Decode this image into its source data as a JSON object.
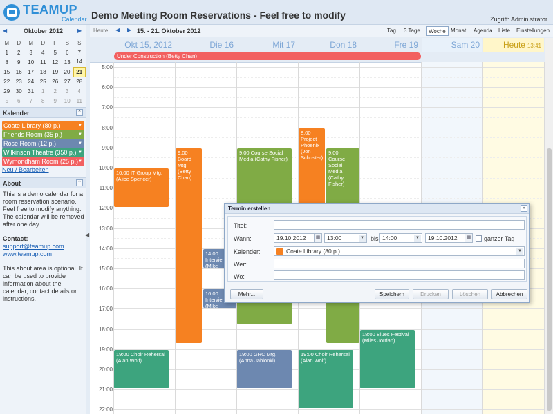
{
  "header": {
    "logo_text": "TEAMUP",
    "logo_sub": "Calendar",
    "title": "Demo Meeting Room Reservations - Feel free to modify",
    "access": "Zugriff: Administrator"
  },
  "mini_calendar": {
    "month": "Oktober 2012",
    "weekdays": [
      "M",
      "D",
      "M",
      "D",
      "F",
      "S",
      "S"
    ],
    "weeks": [
      [
        "1",
        "2",
        "3",
        "4",
        "5",
        "6",
        "7"
      ],
      [
        "8",
        "9",
        "10",
        "11",
        "12",
        "13",
        "14"
      ],
      [
        "15",
        "16",
        "17",
        "18",
        "19",
        "20",
        "21"
      ],
      [
        "22",
        "23",
        "24",
        "25",
        "26",
        "27",
        "28"
      ],
      [
        "29",
        "30",
        "31",
        "1",
        "2",
        "3",
        "4"
      ],
      [
        "5",
        "6",
        "7",
        "8",
        "9",
        "10",
        "11"
      ]
    ]
  },
  "calendars_panel": {
    "title": "Kalender",
    "items": [
      {
        "label": "Coate Library (80 p.)",
        "color": "#f68121"
      },
      {
        "label": "Friends Room (35 p.)",
        "color": "#80ab45"
      },
      {
        "label": "Rose Room (12 p.)",
        "color": "#6d88b0"
      },
      {
        "label": "Wilkinson Theatre (350 p.)",
        "color": "#3da47e"
      },
      {
        "label": "Wymondham Room (25 p.)",
        "color": "#f26060"
      }
    ],
    "edit_link": "Neu / Bearbeiten"
  },
  "about_panel": {
    "title": "About",
    "text1": "This is a demo calendar for a room reservation scenario. Feel free to modify anything. The calendar will be removed after one day.",
    "contact_label": "Contact",
    "email": "support@teamup.com",
    "website": "www.teamup.com",
    "text2": "This about area is optional. It can be used to provide information about the calendar, contact details or instructions."
  },
  "toolbar": {
    "today": "Heute",
    "range": "15. - 21. Oktober 2012",
    "views": [
      "Tag",
      "3 Tage",
      "Woche",
      "Monat",
      "Agenda",
      "Liste",
      "Einstellungen"
    ],
    "active_view": "Woche"
  },
  "days": [
    {
      "label": "Okt 15, 2012"
    },
    {
      "label": "Die 16"
    },
    {
      "label": "Mit 17"
    },
    {
      "label": "Don 18"
    },
    {
      "label": "Fre 19"
    },
    {
      "label": "Sam 20"
    },
    {
      "label": "Heute",
      "extra": "13:41"
    }
  ],
  "hours": [
    "5:00",
    "6:00",
    "7:00",
    "8:00",
    "9:00",
    "10:00",
    "11:00",
    "12:00",
    "13:00",
    "14:00",
    "15:00",
    "16:00",
    "17:00",
    "18:00",
    "19:00",
    "20:00",
    "21:00",
    "22:00"
  ],
  "allday_event": {
    "title": "Under Construction (Betty Chan)"
  },
  "events": [
    {
      "day": 0,
      "start": 10,
      "end": 12,
      "cal": "orange",
      "lines": [
        "10:00 IT Group Mtg.",
        "(Alice Spencer)"
      ]
    },
    {
      "day": 1,
      "start": 9,
      "end": 18.75,
      "cal": "orange",
      "lines": [
        "9:00",
        "Board",
        "Mtg.",
        "(Betty",
        "Chan)"
      ]
    },
    {
      "day": 1.45,
      "start": 14,
      "end": 15,
      "cal": "blue",
      "lines": [
        "14:00",
        "Intervie",
        "(Mike"
      ]
    },
    {
      "day": 1.45,
      "start": 16,
      "end": 17,
      "cal": "blue",
      "lines": [
        "16:00",
        "Intervie",
        "(Mike"
      ]
    },
    {
      "day": 2,
      "start": 9,
      "end": 17.8,
      "cal": "green",
      "lines": [
        "9:00 Course Social",
        "Media (Cathy Fisher)"
      ]
    },
    {
      "day": 3,
      "start": 8,
      "end": 12.5,
      "cal": "orange",
      "lines": [
        "8:00",
        "Project",
        "Phoenix",
        "(Jon",
        "Schuster)"
      ]
    },
    {
      "day": 3.45,
      "start": 9,
      "end": 18.75,
      "cal": "green",
      "lines": [
        "9:00",
        "Course",
        "Social",
        "Media",
        "(Cathy",
        "Fisher)"
      ]
    },
    {
      "day": 4,
      "start": 18,
      "end": 21,
      "cal": "teal",
      "lines": [
        "18:00 Blues Festival",
        "(Miles Jordan)"
      ]
    },
    {
      "day": 0,
      "start": 19,
      "end": 21,
      "cal": "teal",
      "lines": [
        "19:00 Choir Rehersal",
        "(Alan Wolf)"
      ]
    },
    {
      "day": 2,
      "start": 19,
      "end": 21,
      "cal": "blue",
      "lines": [
        "19:00 GRC Mtg.",
        "(Anna Jablonki)"
      ]
    },
    {
      "day": 3,
      "start": 19,
      "end": 22,
      "cal": "teal",
      "lines": [
        "19:00 Choir Rehersal",
        "(Alan Wolf)"
      ]
    }
  ],
  "dialog": {
    "title": "Termin erstellen",
    "fields": {
      "title_label": "Titel:",
      "title_value": "",
      "when_label": "Wann:",
      "start_date": "19.10.2012",
      "start_time": "13:00",
      "until_label": "bis",
      "end_time": "14:00",
      "end_date": "19.10.2012",
      "allday_label": "ganzer Tag",
      "calendar_label": "Kalender:",
      "calendar_value": "Coate Library (80 p.)",
      "who_label": "Wer:",
      "who_value": "",
      "where_label": "Wo:",
      "where_value": ""
    },
    "buttons": {
      "more": "Mehr...",
      "save": "Speichern",
      "print": "Drucken",
      "delete": "Löschen",
      "cancel": "Abbrechen"
    }
  },
  "colors": {
    "orange": "#f68121",
    "green": "#80ab45",
    "blue": "#6d88b0",
    "teal": "#3da47e",
    "red": "#f26060",
    "accent": "#2f8fd7"
  }
}
